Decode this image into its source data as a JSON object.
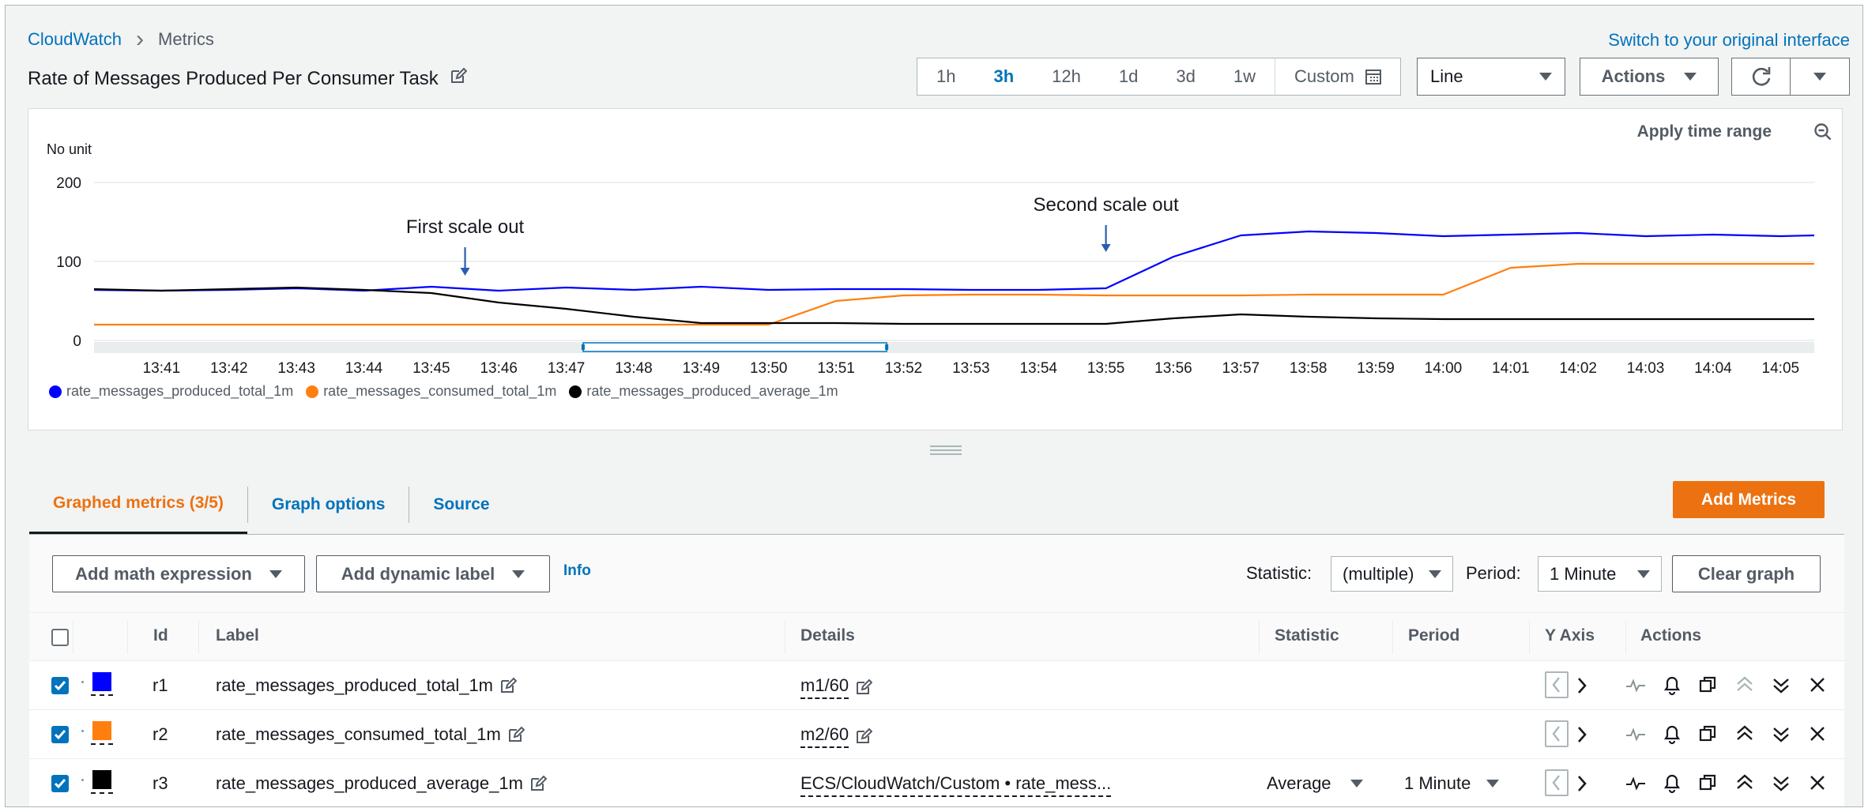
{
  "breadcrumb": {
    "root": "CloudWatch",
    "current": "Metrics"
  },
  "switch_link": "Switch to your original interface",
  "page_title": "Rate of Messages Produced Per Consumer Task",
  "time_range": {
    "options": [
      "1h",
      "3h",
      "12h",
      "1d",
      "3d",
      "1w"
    ],
    "active": "3h",
    "custom_label": "Custom"
  },
  "view_select": {
    "value": "Line"
  },
  "actions_label": "Actions",
  "chart_panel": {
    "apply_label": "Apply time range"
  },
  "chart_data": {
    "type": "line",
    "ylabel": "No unit",
    "ylim": [
      0,
      200
    ],
    "yticks": [
      0,
      100,
      200
    ],
    "x": [
      "13:40",
      "13:41",
      "13:42",
      "13:43",
      "13:44",
      "13:45",
      "13:46",
      "13:47",
      "13:48",
      "13:49",
      "13:50",
      "13:51",
      "13:52",
      "13:53",
      "13:54",
      "13:55",
      "13:56",
      "13:57",
      "13:58",
      "13:59",
      "14:00",
      "14:01",
      "14:02",
      "14:03",
      "14:04",
      "14:05",
      "14:05.5"
    ],
    "x_tick_labels": [
      "13:41",
      "13:42",
      "13:43",
      "13:44",
      "13:45",
      "13:46",
      "13:47",
      "13:48",
      "13:49",
      "13:50",
      "13:51",
      "13:52",
      "13:53",
      "13:54",
      "13:55",
      "13:56",
      "13:57",
      "13:58",
      "13:59",
      "14:00",
      "14:01",
      "14:02",
      "14:03",
      "14:04",
      "14:05"
    ],
    "series": [
      {
        "name": "rate_messages_produced_total_1m",
        "color": "#0000ff",
        "values": [
          64,
          63,
          64,
          66,
          63,
          68,
          63,
          67,
          64,
          68,
          64,
          65,
          65,
          64,
          64,
          66,
          106,
          133,
          138,
          136,
          132,
          134,
          136,
          132,
          134,
          132,
          133
        ]
      },
      {
        "name": "rate_messages_consumed_total_1m",
        "color": "#ff7f0e",
        "values": [
          20,
          20,
          20,
          20,
          20,
          20,
          20,
          20,
          20,
          20,
          20,
          50,
          57,
          58,
          58,
          57,
          57,
          57,
          58,
          58,
          58,
          92,
          97,
          97,
          97,
          97,
          97
        ]
      },
      {
        "name": "rate_messages_produced_average_1m",
        "color": "#000000",
        "values": [
          65,
          63,
          65,
          67,
          64,
          60,
          48,
          40,
          30,
          22,
          22,
          22,
          21,
          21,
          21,
          21,
          28,
          33,
          30,
          28,
          27,
          27,
          27,
          27,
          27,
          27,
          27
        ]
      }
    ],
    "annotations": [
      {
        "text": "First scale out",
        "x": "13:45.5"
      },
      {
        "text": "Second scale out",
        "x": "13:55"
      }
    ],
    "grid": true,
    "legend": "bottom-left"
  },
  "tabs": [
    {
      "label": "Graphed metrics (3/5)",
      "active": true
    },
    {
      "label": "Graph options",
      "active": false
    },
    {
      "label": "Source",
      "active": false
    }
  ],
  "add_metrics_label": "Add Metrics",
  "toolbar": {
    "math_label": "Add math expression",
    "dynamic_label": "Add dynamic label",
    "info_label": "Info",
    "statistic_label": "Statistic:",
    "statistic_value": "(multiple)",
    "period_label": "Period:",
    "period_value": "1 Minute",
    "clear_label": "Clear graph"
  },
  "table": {
    "headers": {
      "id": "Id",
      "label": "Label",
      "details": "Details",
      "statistic": "Statistic",
      "period": "Period",
      "yaxis": "Y Axis",
      "actions": "Actions"
    },
    "rows": [
      {
        "id": "r1",
        "label": "rate_messages_produced_total_1m",
        "details": "m1/60",
        "statistic": "",
        "period": "",
        "color": "#0000ff"
      },
      {
        "id": "r2",
        "label": "rate_messages_consumed_total_1m",
        "details": "m2/60",
        "statistic": "",
        "period": "",
        "color": "#ff7f0e"
      },
      {
        "id": "r3",
        "label": "rate_messages_produced_average_1m",
        "details": "ECS/CloudWatch/Custom • rate_mess...",
        "statistic": "Average",
        "period": "1 Minute",
        "color": "#000000"
      }
    ]
  }
}
